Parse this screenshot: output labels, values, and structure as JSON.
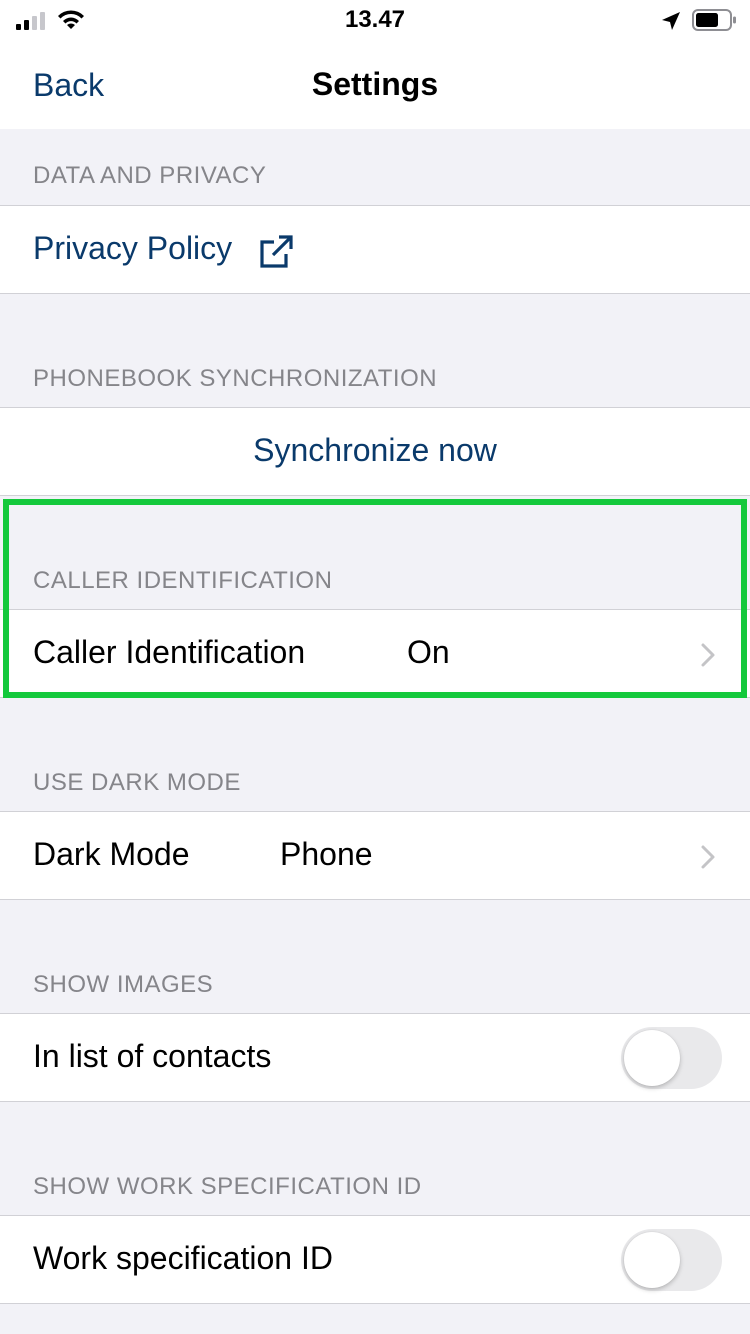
{
  "status_bar": {
    "time": "13.47"
  },
  "navbar": {
    "back_label": "Back",
    "title": "Settings"
  },
  "sections": {
    "data_privacy": {
      "header": "DATA AND PRIVACY",
      "privacy_policy_label": "Privacy Policy"
    },
    "phonebook": {
      "header": "PHONEBOOK SYNCHRONIZATION",
      "sync_label": "Synchronize now"
    },
    "caller_id": {
      "header": "CALLER IDENTIFICATION",
      "label": "Caller Identification",
      "value": "On"
    },
    "dark_mode": {
      "header": "USE DARK MODE",
      "label": "Dark Mode",
      "value": "Phone"
    },
    "show_images": {
      "header": "SHOW IMAGES",
      "label": "In list of contacts",
      "toggle_on": false
    },
    "work_spec": {
      "header": "SHOW WORK SPECIFICATION ID",
      "label": "Work specification ID",
      "toggle_on": false
    }
  },
  "colors": {
    "link": "#0a3a6b",
    "background": "#f2f2f7",
    "highlight": "#14c93c"
  }
}
